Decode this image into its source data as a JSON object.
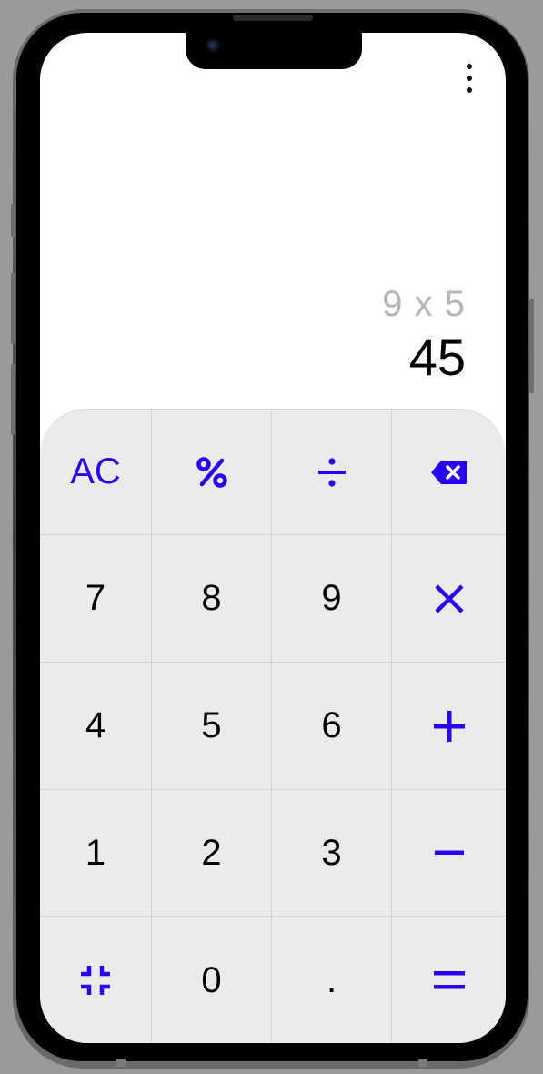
{
  "display": {
    "expression": "9 x 5",
    "result": "45"
  },
  "menu": {
    "icon": "more-vertical-icon"
  },
  "colors": {
    "accent": "#2a00f0",
    "keypad_background": "#ebebeb",
    "expression_text": "#b5b5b5",
    "result_text": "#000000"
  },
  "keypad": {
    "ac_label": "AC",
    "percent_icon": "percent-icon",
    "divide_icon": "divide-icon",
    "backspace_icon": "backspace-icon",
    "seven": "7",
    "eight": "8",
    "nine": "9",
    "multiply_icon": "multiply-icon",
    "four": "4",
    "five": "5",
    "six": "6",
    "plus_icon": "plus-icon",
    "one": "1",
    "two": "2",
    "three": "3",
    "minus_icon": "minus-icon",
    "collapse_icon": "collapse-icon",
    "zero": "0",
    "decimal": ".",
    "equals_icon": "equals-icon"
  }
}
